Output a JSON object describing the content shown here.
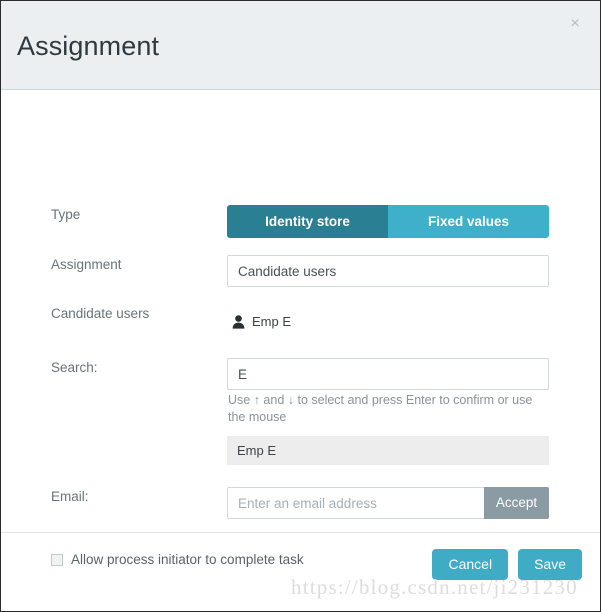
{
  "dialog": {
    "title": "Assignment",
    "close_icon": "close-icon",
    "close_label": "×"
  },
  "form": {
    "type": {
      "label": "Type",
      "options": [
        {
          "label": "Identity store",
          "active": true
        },
        {
          "label": "Fixed values",
          "active": false
        }
      ]
    },
    "assignment": {
      "label": "Assignment",
      "value": "Candidate users"
    },
    "candidate_users": {
      "label": "Candidate users",
      "icon": "user-icon",
      "items": [
        "Emp E"
      ]
    },
    "search": {
      "label": "Search:",
      "value": "E",
      "placeholder": "",
      "help_text": "Use ↑ and ↓ to select and press Enter to confirm or use the mouse",
      "suggestions": [
        "Emp E"
      ]
    },
    "email": {
      "label": "Email:",
      "value": "",
      "placeholder": "Enter an email address",
      "accept_label": "Accept"
    },
    "allow_initiator": {
      "label": "Allow process initiator to complete task",
      "checked": false
    }
  },
  "footer": {
    "cancel_label": "Cancel",
    "save_label": "Save"
  },
  "watermark": {
    "text": "https://blog.csdn.net/ji231230"
  },
  "colors": {
    "accent": "#3fabc4",
    "accent_dark": "#2a7f93",
    "accent_light": "#3fb0ca",
    "accept_gray": "#8a9ba4",
    "header_bg": "#eceff1",
    "suggestion_bg": "#ededed"
  }
}
